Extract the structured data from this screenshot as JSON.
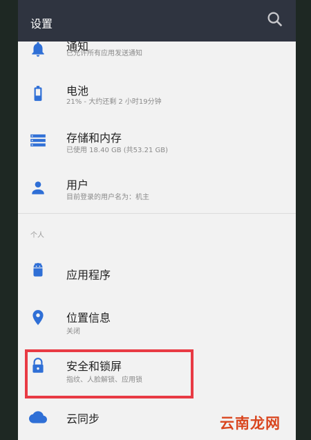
{
  "header": {
    "title": "设置"
  },
  "items": [
    {
      "title": "通知",
      "summary": "已允许所有应用发送通知",
      "icon": "bell-icon"
    },
    {
      "title": "电池",
      "summary": "21% - 大约还剩 2 小时19分钟",
      "icon": "battery-icon"
    },
    {
      "title": "存储和内存",
      "summary": "已使用 18.40 GB (共53.21 GB)",
      "icon": "storage-icon"
    },
    {
      "title": "用户",
      "summary": "目前登录的用户名为：机主",
      "icon": "person-icon"
    }
  ],
  "section": {
    "label": "个人"
  },
  "personal_items": [
    {
      "title": "应用程序",
      "summary": "",
      "icon": "android-icon"
    },
    {
      "title": "位置信息",
      "summary": "关闭",
      "icon": "location-icon"
    },
    {
      "title": "安全和锁屏",
      "summary": "指纹、人脸解锁、应用锁",
      "icon": "lock-icon"
    },
    {
      "title": "云同步",
      "summary": "",
      "icon": "cloud-icon"
    }
  ],
  "watermark": "云南龙网",
  "colors": {
    "accent": "#2f6fd6",
    "appbar": "#2f3440",
    "highlight": "#e83a44"
  }
}
